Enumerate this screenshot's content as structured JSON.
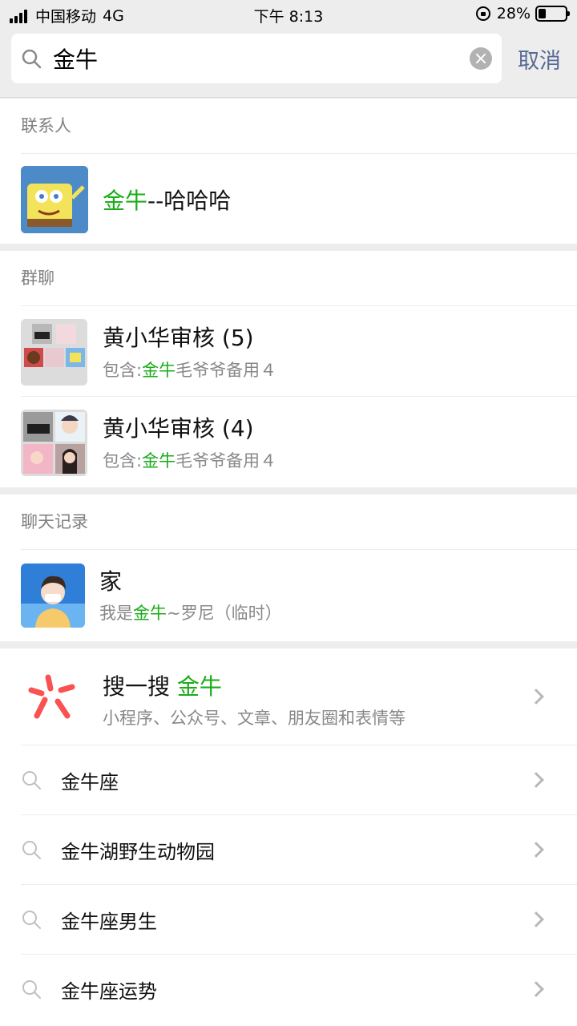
{
  "status": {
    "carrier": "中国移动",
    "network": "4G",
    "time": "下午 8:13",
    "battery": "28%",
    "battery_level": 0.28
  },
  "search": {
    "query": "金牛",
    "cancel_label": "取消"
  },
  "contacts": {
    "title": "联系人",
    "items": [
      {
        "name_highlight": "金牛",
        "name_rest": "--哈哈哈"
      }
    ]
  },
  "groups": {
    "title": "群聊",
    "items": [
      {
        "name": "黄小华审核 (5)",
        "sub_prefix": "包含:",
        "sub_highlight": "金牛",
        "sub_rest": "毛爷爷备用４"
      },
      {
        "name": "黄小华审核 (4)",
        "sub_prefix": "包含:",
        "sub_highlight": "金牛",
        "sub_rest": "毛爷爷备用４"
      }
    ]
  },
  "chats": {
    "title": "聊天记录",
    "items": [
      {
        "name": "家",
        "sub_prefix": "我是",
        "sub_highlight": "金牛",
        "sub_rest": "~罗尼（临时）"
      }
    ]
  },
  "souyisou": {
    "label": "搜一搜",
    "keyword": "金牛",
    "sub": "小程序、公众号、文章、朋友圈和表情等"
  },
  "suggestions": [
    "金牛座",
    "金牛湖野生动物园",
    "金牛座男生",
    "金牛座运势"
  ],
  "colors": {
    "highlight": "#1aad19",
    "link": "#576b95",
    "background": "#ededed"
  }
}
